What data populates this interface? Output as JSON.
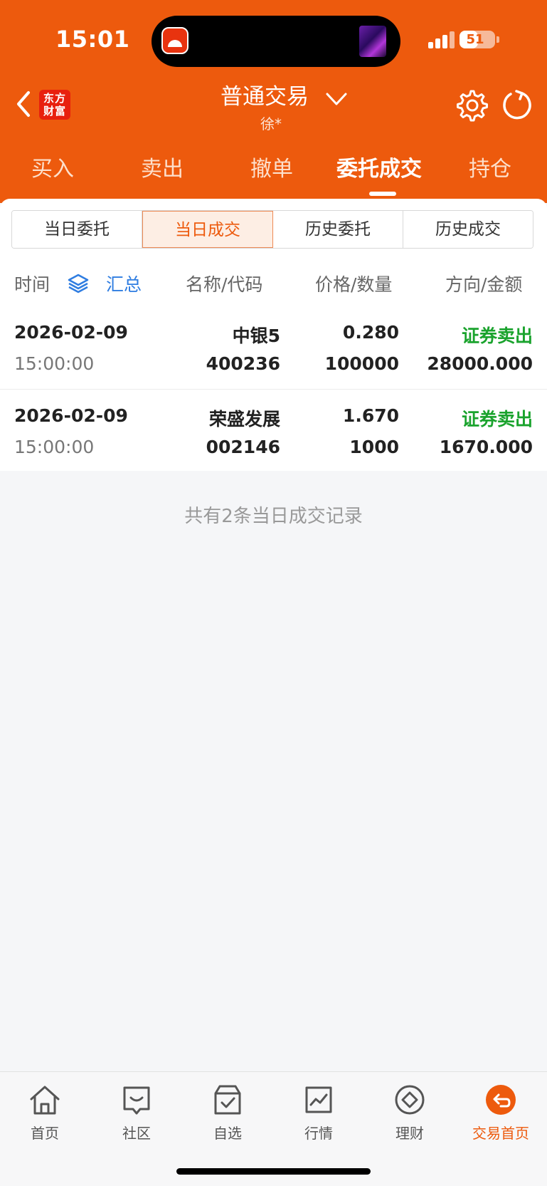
{
  "status_bar": {
    "time": "15:01",
    "battery": "51",
    "battery_level": 0.51
  },
  "header": {
    "brand_logo_text": "东方财富",
    "brand_line1": "东方",
    "brand_line2": "财富",
    "title": "普通交易",
    "account_name": "徐*"
  },
  "main_tabs": [
    {
      "label": "买入"
    },
    {
      "label": "卖出"
    },
    {
      "label": "撤单"
    },
    {
      "label": "委托成交",
      "active": true
    },
    {
      "label": "持仓"
    }
  ],
  "sub_tabs": [
    {
      "label": "当日委托"
    },
    {
      "label": "当日成交",
      "active": true
    },
    {
      "label": "历史委托"
    },
    {
      "label": "历史成交"
    }
  ],
  "columns": {
    "time": "时间",
    "summary": "汇总",
    "name_code": "名称/代码",
    "price_qty": "价格/数量",
    "direction_amount": "方向/金额"
  },
  "trades": [
    {
      "date": "2026-02-09",
      "time": "15:00:00",
      "name": "中银5",
      "code": "400236",
      "price": "0.280",
      "quantity": "100000",
      "direction": "证券卖出",
      "amount": "28000.000"
    },
    {
      "date": "2026-02-09",
      "time": "15:00:00",
      "name": "荣盛发展",
      "code": "002146",
      "price": "1.670",
      "quantity": "1000",
      "direction": "证券卖出",
      "amount": "1670.000"
    }
  ],
  "footer_note": "共有2条当日成交记录",
  "bottom_nav": [
    {
      "label": "首页",
      "icon": "home-icon"
    },
    {
      "label": "社区",
      "icon": "chat-icon"
    },
    {
      "label": "自选",
      "icon": "watchlist-icon"
    },
    {
      "label": "行情",
      "icon": "chart-icon"
    },
    {
      "label": "理财",
      "icon": "diamond-icon"
    },
    {
      "label": "交易首页",
      "icon": "trade-return-icon",
      "active": true
    }
  ],
  "colors": {
    "brand": "#ed5a0d",
    "sell": "#1aa32d",
    "link": "#2f7de1"
  }
}
